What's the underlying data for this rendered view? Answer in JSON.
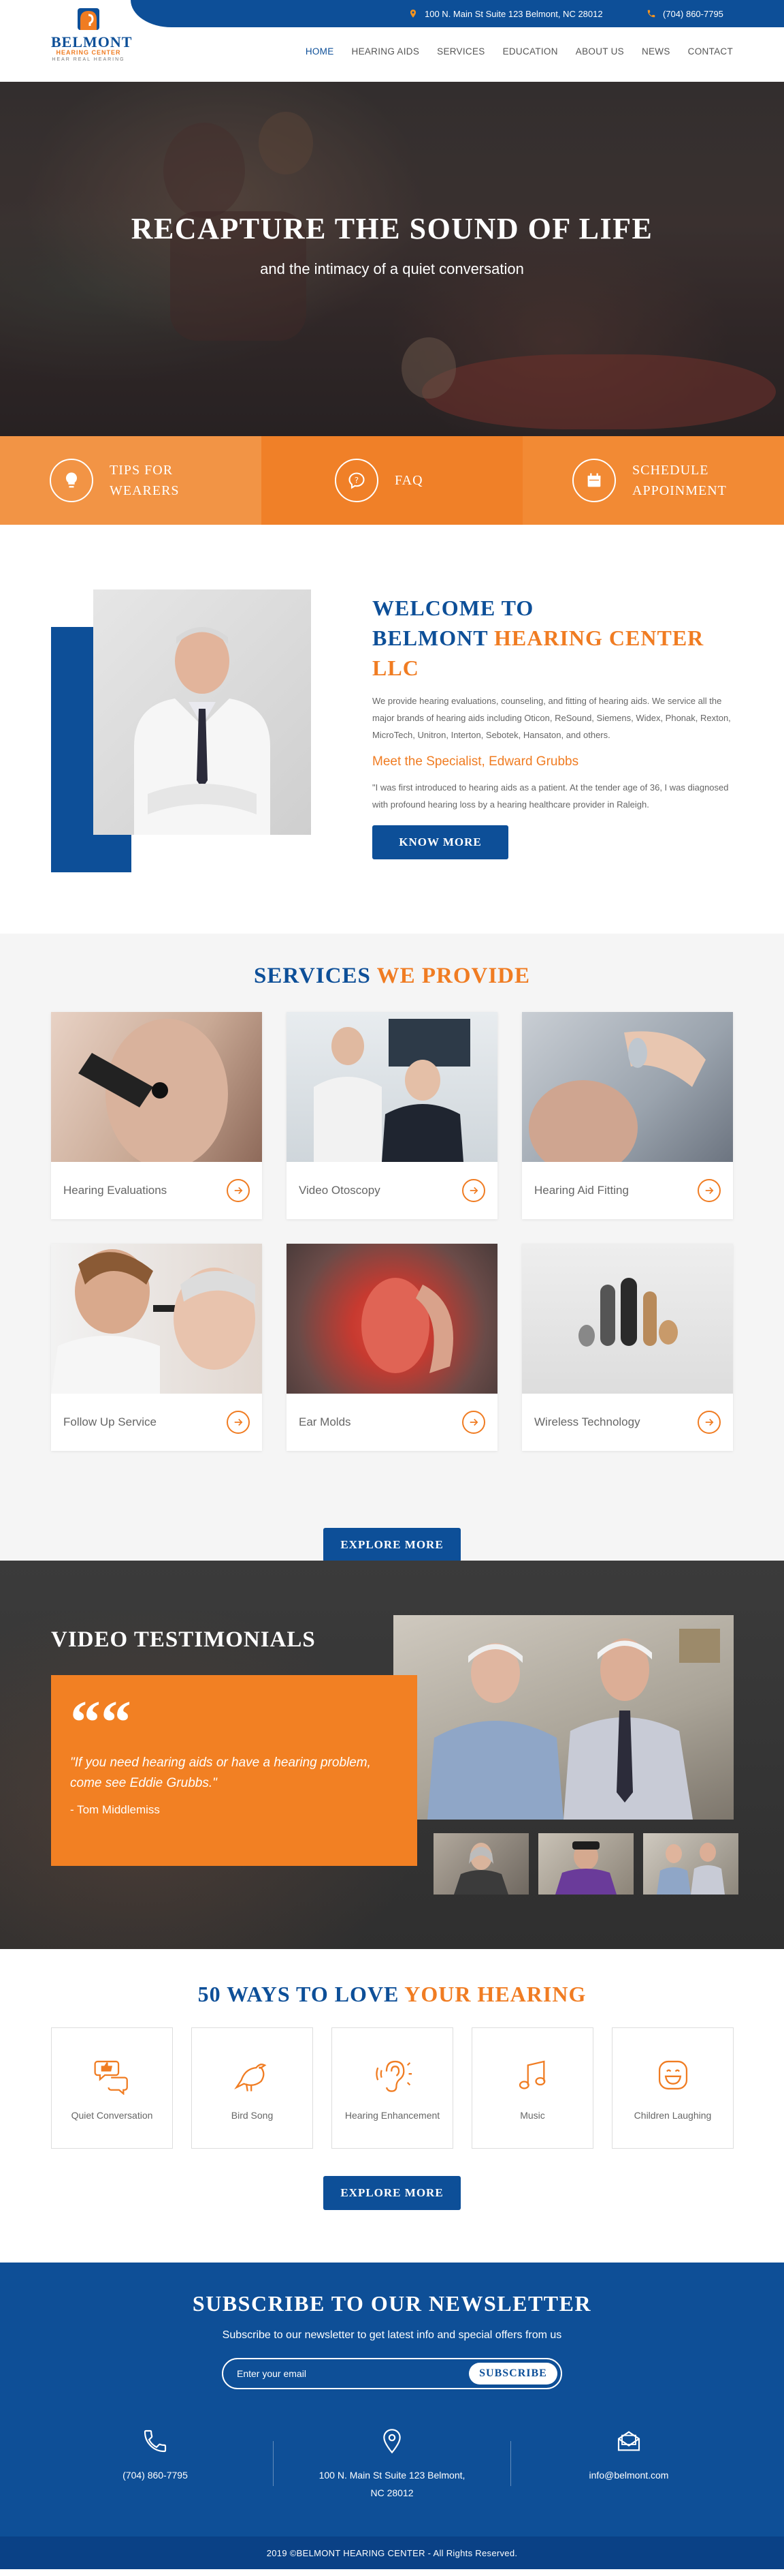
{
  "colors": {
    "brand_blue": "#0d4f98",
    "brand_orange": "#f07c22",
    "dark_bg": "#333333"
  },
  "topbar": {
    "address": "100 N. Main St Suite 123 Belmont, NC 28012",
    "phone": "(704) 860-7795"
  },
  "logo": {
    "name": "BELMONT",
    "sub": "HEARING CENTER",
    "tag": "HEAR REAL HEARING"
  },
  "nav": [
    {
      "label": "HOME",
      "active": true
    },
    {
      "label": "HEARING AIDS"
    },
    {
      "label": "SERVICES"
    },
    {
      "label": "EDUCATION"
    },
    {
      "label": "ABOUT US"
    },
    {
      "label": "NEWS"
    },
    {
      "label": "CONTACT"
    }
  ],
  "hero": {
    "title": "RECAPTURE THE SOUND OF LIFE",
    "subtitle": "and the intimacy of a quiet conversation"
  },
  "features": [
    {
      "label": "TIPS FOR WEARERS",
      "icon": "lightbulb-icon"
    },
    {
      "label": "FAQ",
      "icon": "question-chat-icon"
    },
    {
      "label": "SCHEDULE APPOINMENT",
      "icon": "calendar-icon"
    }
  ],
  "welcome": {
    "title_line1": "WELCOME TO",
    "title_blue": "BELMONT ",
    "title_orange": "HEARING CENTER LLC",
    "body": "We provide hearing evaluations, counseling, and fitting of hearing aids. We service all the major brands of hearing aids including Oticon, ReSound, Siemens, Widex, Phonak, Rexton, MicroTech, Unitron, Interton, Sebotek, Hansaton, and others.",
    "meet": "Meet the Specialist, Edward Grubbs",
    "quote": "\"I was first introduced to hearing aids as a patient. At the tender age of 36, I was diagnosed with profound hearing loss by a hearing healthcare provider in Raleigh.",
    "button": "KNOW MORE"
  },
  "services": {
    "title_blue": "SERVICES ",
    "title_orange": "WE PROVIDE",
    "items": [
      {
        "label": "Hearing Evaluations"
      },
      {
        "label": "Video Otoscopy"
      },
      {
        "label": "Hearing Aid Fitting"
      },
      {
        "label": "Follow Up Service"
      },
      {
        "label": "Ear Molds"
      },
      {
        "label": "Wireless Technology"
      }
    ],
    "button": "EXPLORE MORE"
  },
  "testimonials": {
    "title": "VIDEO TESTIMONIALS",
    "quote_mark": "““",
    "quote": "\"If you need hearing aids or have a hearing problem, come see Eddie Grubbs.\"",
    "author": "- Tom Middlemiss"
  },
  "ways": {
    "title_blue": "50 WAYS TO LOVE ",
    "title_orange": "YOUR HEARING",
    "items": [
      {
        "label": "Quiet Conversation",
        "icon": "thumbs-up-chat-icon"
      },
      {
        "label": "Bird Song",
        "icon": "bird-icon"
      },
      {
        "label": "Hearing Enhancement",
        "icon": "ear-icon"
      },
      {
        "label": "Music",
        "icon": "music-note-icon"
      },
      {
        "label": "Children Laughing",
        "icon": "smiley-icon"
      }
    ],
    "button": "EXPLORE MORE"
  },
  "newsletter": {
    "title": "SUBSCRIBE TO OUR NEWSLETTER",
    "subtitle": "Subscribe to our newsletter to get latest info and special offers from us",
    "placeholder": "Enter your email",
    "button": "SUBSCRIBE",
    "phone": "(704) 860-7795",
    "address_line1": "100 N. Main St Suite 123 Belmont,",
    "address_line2": "NC 28012",
    "email": "info@belmont.com"
  },
  "footer": {
    "copyright": "2019 ©BELMONT HEARING CENTER - All Rights Reserved."
  }
}
